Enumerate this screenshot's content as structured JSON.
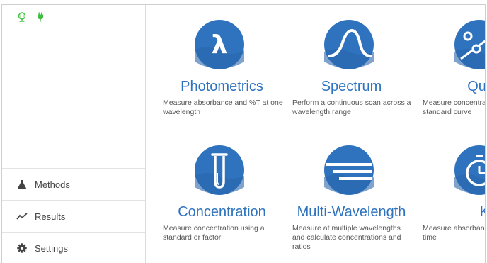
{
  "status_bar": {
    "icons": [
      "globe-icon",
      "plug-icon"
    ],
    "color": "#3fbf3f"
  },
  "sidebar": {
    "items": [
      {
        "label": "Methods",
        "icon": "flask-icon"
      },
      {
        "label": "Results",
        "icon": "trend-line-icon"
      },
      {
        "label": "Settings",
        "icon": "gear-icon"
      }
    ]
  },
  "tiles": [
    {
      "title": "Photometrics",
      "description": "Measure absorbance and %T at one wavelength",
      "icon": "lambda-icon"
    },
    {
      "title": "Spectrum",
      "description": "Perform a continuous scan across a wavelength range",
      "icon": "spectrum-curve-icon"
    },
    {
      "title": "Quantit",
      "description": "Measure concentrat standard curve",
      "icon": "quantitation-icon"
    },
    {
      "title": "Concentration",
      "description": "Measure concentration using a standard or factor",
      "icon": "test-tube-icon"
    },
    {
      "title": "Multi-Wavelength",
      "description": "Measure at multiple wavelengths and calculate concentrations and ratios",
      "icon": "multi-lines-icon"
    },
    {
      "title": "Kinet",
      "description": "Measure absorband time",
      "icon": "stopwatch-icon"
    }
  ],
  "colors": {
    "accent": "#2f73bf",
    "icon_bg": "#2f73bf"
  }
}
